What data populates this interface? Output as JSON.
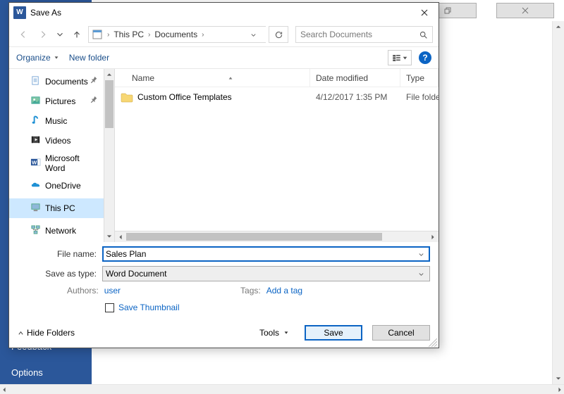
{
  "backdrop": {
    "sidebar_items_bottom": [
      "Feedback",
      "Options"
    ]
  },
  "dialog": {
    "title": "Save As",
    "breadcrumb": [
      "This PC",
      "Documents"
    ],
    "search_placeholder": "Search Documents",
    "toolbar": {
      "organize": "Organize",
      "new_folder": "New folder"
    },
    "tree": [
      {
        "label": "Documents",
        "icon": "doc",
        "pinned": true
      },
      {
        "label": "Pictures",
        "icon": "pics",
        "pinned": true
      },
      {
        "label": "Music",
        "icon": "music"
      },
      {
        "label": "Videos",
        "icon": "video"
      },
      {
        "label": "Microsoft Word",
        "icon": "word",
        "spaced": true
      },
      {
        "label": "OneDrive",
        "icon": "onedrive",
        "spaced": true
      },
      {
        "label": "This PC",
        "icon": "thispc",
        "selected": true,
        "spaced": true
      },
      {
        "label": "Network",
        "icon": "network",
        "spaced": true
      }
    ],
    "columns": {
      "name": "Name",
      "date": "Date modified",
      "type": "Type"
    },
    "rows": [
      {
        "name": "Custom Office Templates",
        "date": "4/12/2017 1:35 PM",
        "type": "File folder"
      }
    ],
    "form": {
      "filename_label": "File name:",
      "filename_value": "Sales Plan",
      "type_label": "Save as type:",
      "type_value": "Word Document",
      "authors_label": "Authors:",
      "authors_value": "user",
      "tags_label": "Tags:",
      "tags_value": "Add a tag",
      "save_thumbnail": "Save Thumbnail"
    },
    "actions": {
      "hide_folders": "Hide Folders",
      "tools": "Tools",
      "save": "Save",
      "cancel": "Cancel"
    }
  }
}
